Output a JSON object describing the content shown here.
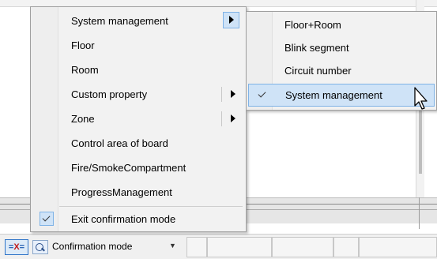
{
  "main_menu": {
    "items": [
      {
        "label": "System management",
        "submenu": true,
        "open": true
      },
      {
        "label": "Floor"
      },
      {
        "label": "Room"
      },
      {
        "label": "Custom property",
        "submenu": true
      },
      {
        "label": "Zone",
        "submenu": true
      },
      {
        "label": "Control area of board"
      },
      {
        "label": "Fire/SmokeCompartment"
      },
      {
        "label": "ProgressManagement"
      },
      {
        "label": "Exit confirmation mode",
        "checked": true
      }
    ]
  },
  "sub_menu": {
    "items": [
      {
        "label": "Floor+Room"
      },
      {
        "label": "Blink segment"
      },
      {
        "label": "Circuit number"
      },
      {
        "label": "System management",
        "checked": true,
        "highlighted": true
      }
    ]
  },
  "status_bar": {
    "mode_icon_text": "X",
    "mode_label": "Confirmation mode"
  },
  "colors": {
    "highlight_fill": "#cfe3f7",
    "highlight_border": "#7fb3e6",
    "menu_background": "#f2f2f2"
  },
  "icons": [
    "checkmark-icon",
    "submenu-arrow-icon",
    "mouse-cursor-icon",
    "confirmation-mode-icon",
    "dropdown-arrow-icon"
  ]
}
